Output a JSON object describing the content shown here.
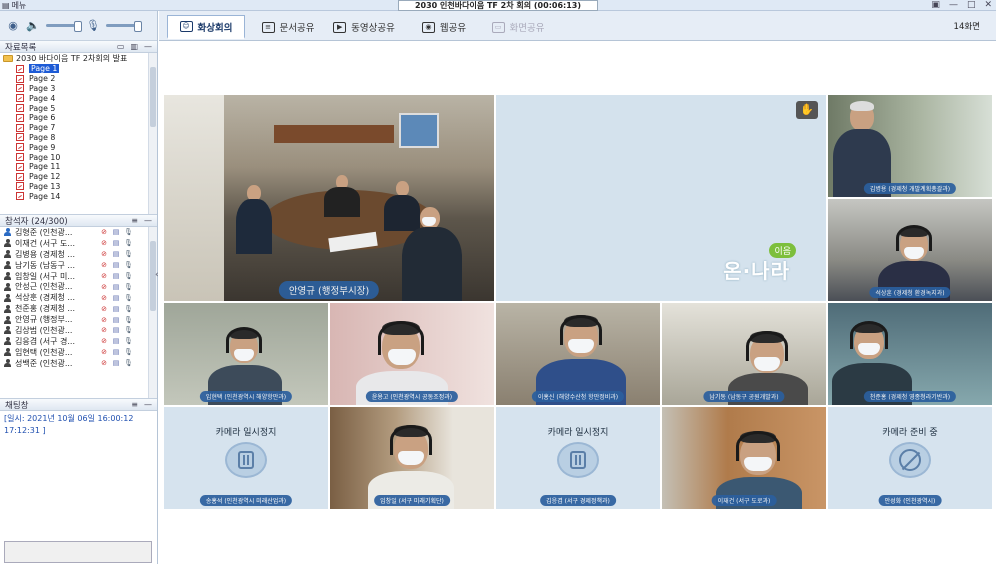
{
  "window": {
    "title": "2030 인천바다이음 TF 2차 회의 (00:06:13)",
    "menu_label": "메뉴",
    "controls": [
      "▣",
      "—",
      "□",
      "✕"
    ]
  },
  "left": {
    "doc_list_title": "자료목록",
    "doc_root": "2030 바다이음 TF 2차회의 발표",
    "pages": [
      "Page 1",
      "Page 2",
      "Page 3",
      "Page 4",
      "Page 5",
      "Page 6",
      "Page 7",
      "Page 8",
      "Page 9",
      "Page 10",
      "Page 11",
      "Page 12",
      "Page 13",
      "Page 14"
    ],
    "attendees_title": "참석자 (24/300)",
    "attendees": [
      {
        "name": "김형준 (인천광..."
      },
      {
        "name": "이재건 (서구 도..."
      },
      {
        "name": "김병용 (경제청 ..."
      },
      {
        "name": "남기동 (남동구 ..."
      },
      {
        "name": "임창일 (서구 미..."
      },
      {
        "name": "안성근 (인천광..."
      },
      {
        "name": "석상훈 (경제청 ..."
      },
      {
        "name": "천준홍 (경제청 ..."
      },
      {
        "name": "안영규 (행정부..."
      },
      {
        "name": "김상범 (인천광..."
      },
      {
        "name": "김응겸 (서구 경..."
      },
      {
        "name": "임현택 (인천광..."
      },
      {
        "name": "성백준 (인천광..."
      }
    ],
    "chat_title": "채팅창",
    "chat_lines": [
      "[일시: 2021년 10월 06일 16:00:12",
      "17:12:31 ]"
    ]
  },
  "tabs": [
    {
      "label": "화상회의",
      "icon": "☺"
    },
    {
      "label": "문서공유",
      "icon": "≡"
    },
    {
      "label": "동영상공유",
      "icon": "▶"
    },
    {
      "label": "웹공유",
      "icon": "◉"
    },
    {
      "label": "화면공유",
      "icon": "▭"
    }
  ],
  "screens_count": "14화면",
  "videos": {
    "main_label": "안영규 (행정부시장)",
    "logo_small": "이음",
    "logo_text": "온·나라",
    "tiles": [
      {
        "label": "김병용 (경제청 개발계획총괄과)"
      },
      {
        "label": "석상훈 (경제청 환경녹지과)"
      },
      {
        "label": "임현택 (인천광역시 해양항만과)"
      },
      {
        "label": "윤용고 (인천광역시 공동조정과)"
      },
      {
        "label": "이홍신 (해양수산청 항만정비과)"
      },
      {
        "label": "남기동 (남동구 공원개발과)"
      },
      {
        "label": "천준홍 (경제청 영종청라기반과)"
      },
      {
        "label": "송홍석 (인천광역시 미래산업과)",
        "title": "카메라 일시정지"
      },
      {
        "label": "임창일 (서구 미래기획단)"
      },
      {
        "label": "김응겸 (서구 경제정책과)",
        "title": "카메라 일시정지"
      },
      {
        "label": "이재건 (서구 도로과)"
      },
      {
        "label": "안성화 (인천광역시)",
        "title": "카메라 준비 중"
      }
    ]
  }
}
